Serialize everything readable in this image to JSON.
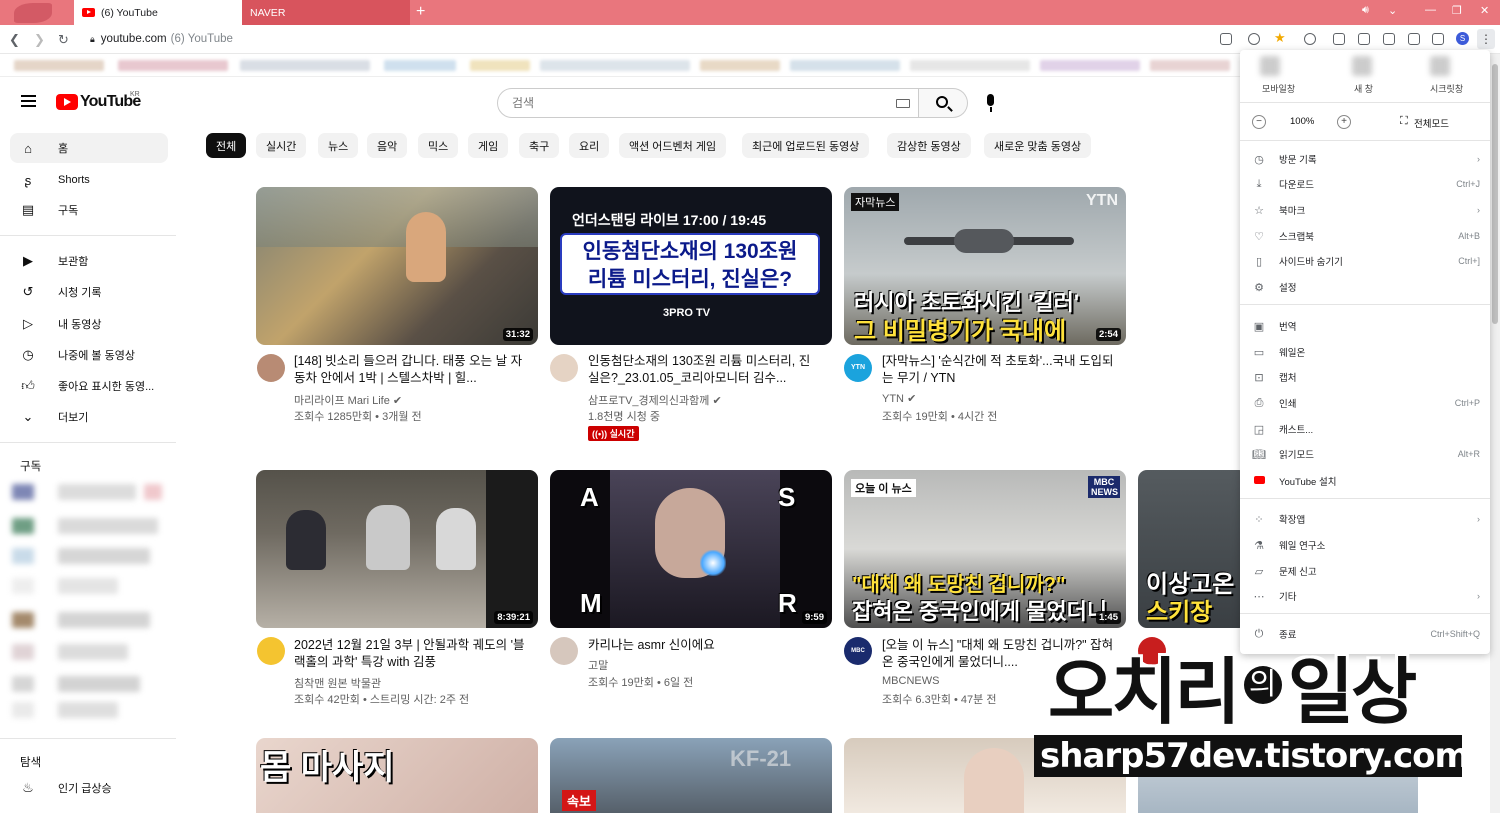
{
  "browser": {
    "tabs": [
      {
        "label": "(6) YouTube"
      },
      {
        "label": "NAVER"
      }
    ],
    "new_tab": "+",
    "url_domain": "youtube.com",
    "url_title": "(6) YouTube"
  },
  "youtube": {
    "logo_text": "YouTube",
    "region": "KR",
    "search_placeholder": "검색"
  },
  "sidebar": {
    "main": [
      {
        "label": "홈",
        "icon": "home-icon"
      },
      {
        "label": "Shorts",
        "icon": "shorts-icon"
      },
      {
        "label": "구독",
        "icon": "subscriptions-icon"
      }
    ],
    "library": [
      {
        "label": "보관함",
        "icon": "library-icon"
      },
      {
        "label": "시청 기록",
        "icon": "history-icon"
      },
      {
        "label": "내 동영상",
        "icon": "your-videos-icon"
      },
      {
        "label": "나중에 볼 동영상",
        "icon": "watch-later-icon"
      },
      {
        "label": "좋아요 표시한 동영...",
        "icon": "liked-icon"
      },
      {
        "label": "더보기",
        "icon": "chevron-down-icon"
      }
    ],
    "subscriptions_header": "구독",
    "explore_header": "탐색",
    "explore": [
      {
        "label": "인기 급상승",
        "icon": "trending-icon"
      }
    ]
  },
  "chips": [
    "전체",
    "실시간",
    "뉴스",
    "음악",
    "믹스",
    "게임",
    "축구",
    "요리",
    "액션 어드벤처 게임",
    "최근에 업로드된 동영상",
    "감상한 동영상",
    "새로운 맞춤 동영상"
  ],
  "videos": [
    {
      "title": "[148] 빗소리 들으러 갑니다. 태풍 오는 날 자동차 안에서 1박 | 스텔스차박 | 힐...",
      "channel": "마리라이프 Mari Life",
      "meta": "조회수 1285만회 • 3개월 전",
      "duration": "31:32"
    },
    {
      "title": "인동첨단소재의 130조원 리튬 미스터리, 진실은?_23.01.05_코리아모니터 김수...",
      "channel": "삼프로TV_경제의신과함께",
      "meta": "1.8천명 시청 중",
      "live": "실시간",
      "thumb_line1": "언더스탠딩 라이브 17:00 / 19:45",
      "thumb_line2": "인동첨단소재의 130조원",
      "thumb_line3": "리튬 미스터리, 진실은?",
      "thumb_logo": "3PRO TV"
    },
    {
      "title": "[자막뉴스] '순식간에 적 초토화'...국내 도입되는 무기 / YTN",
      "channel": "YTN",
      "meta": "조회수 19만회 • 4시간 전",
      "duration": "2:54",
      "thumb_tag": "자막뉴스",
      "thumb_brand": "YTN",
      "thumb_line1": "러시아 초토화시킨 '킬러'",
      "thumb_line2": "그 비밀병기가 국내에"
    },
    {
      "title": "2022년 12월 21일 3부 | 안될과학 궤도의 '블랙홀의 과학' 특강 with 김풍",
      "channel": "침착맨 원본 박물관",
      "meta": "조회수 42만회 • 스트리밍 시간: 2주 전",
      "duration": "8:39:21"
    },
    {
      "title": "카리나는 asmr 신이에요",
      "channel": "고말",
      "meta": "조회수 19만회 • 6일 전",
      "duration": "9:59"
    },
    {
      "title": "[오늘 이 뉴스] \"대체 왜 도망친 겁니까?\" 잡혀온 중국인에게 물었더니....",
      "channel": "MBCNEWS",
      "meta": "조회수 6.3만회 • 47분 전",
      "duration": "1:45",
      "thumb_tag": "오늘 이 뉴스",
      "thumb_brand": "MBC NEWS",
      "thumb_line1": "\"대체 왜 도망친 겁니까?\"",
      "thumb_line2": "잡혀온 중국인에게 물었더니"
    },
    {
      "title": "이상고온 스키장",
      "thumb_line1": "이상고온",
      "thumb_line2": "스키장"
    },
    {
      "title": "몸 마사지",
      "thumb_line1": "몸 마사지"
    },
    {
      "title": "KF-21",
      "thumb_tag": "속보",
      "thumb_line1": "KF-21"
    }
  ],
  "chrome_menu": {
    "top": [
      "모바일창",
      "새 창",
      "시크릿창"
    ],
    "zoom_minus": "−",
    "zoom_value": "100%",
    "zoom_plus": "+",
    "fullscreen": "전체모드",
    "items": [
      {
        "label": "방문 기록",
        "shortcut": "",
        "arrow": "›",
        "icon": "history-icon"
      },
      {
        "label": "다운로드",
        "shortcut": "Ctrl+J",
        "arrow": "",
        "icon": "download-icon"
      },
      {
        "label": "북마크",
        "shortcut": "",
        "arrow": "›",
        "icon": "bookmark-star-icon"
      },
      {
        "label": "스크랩북",
        "shortcut": "Alt+B",
        "arrow": "",
        "icon": "scrapbook-icon"
      },
      {
        "label": "사이드바 숨기기",
        "shortcut": "Ctrl+]",
        "arrow": "",
        "icon": "sidebar-icon"
      },
      {
        "label": "설정",
        "shortcut": "",
        "arrow": "",
        "icon": "gear-icon"
      },
      {
        "label": "번역",
        "shortcut": "",
        "arrow": "",
        "icon": "translate-icon"
      },
      {
        "label": "웨일온",
        "shortcut": "",
        "arrow": "",
        "icon": "whale-on-icon"
      },
      {
        "label": "캡처",
        "shortcut": "",
        "arrow": "",
        "icon": "capture-icon"
      },
      {
        "label": "인쇄",
        "shortcut": "Ctrl+P",
        "arrow": "",
        "icon": "print-icon"
      },
      {
        "label": "캐스트...",
        "shortcut": "",
        "arrow": "",
        "icon": "cast-icon"
      },
      {
        "label": "읽기모드",
        "shortcut": "Alt+R",
        "arrow": "",
        "icon": "reader-icon"
      },
      {
        "label": "YouTube 설치",
        "shortcut": "",
        "arrow": "",
        "icon": "youtube-icon"
      },
      {
        "label": "확장앱",
        "shortcut": "",
        "arrow": "›",
        "icon": "extensions-icon"
      },
      {
        "label": "웨일 연구소",
        "shortcut": "",
        "arrow": "",
        "icon": "lab-icon"
      },
      {
        "label": "문제 신고",
        "shortcut": "",
        "arrow": "",
        "icon": "report-icon"
      },
      {
        "label": "기타",
        "shortcut": "",
        "arrow": "›",
        "icon": "more-icon"
      },
      {
        "label": "종료",
        "shortcut": "Ctrl+Shift+Q",
        "arrow": "",
        "icon": "power-icon"
      }
    ]
  },
  "watermark": {
    "left": "오치리",
    "mid": "의",
    "right": "일상",
    "url": "sharp57dev.tistory.com"
  },
  "colors": {
    "tabbar": "#e9767d",
    "youtube_red": "#ff0000",
    "chip_active": "#0f0f0f"
  }
}
